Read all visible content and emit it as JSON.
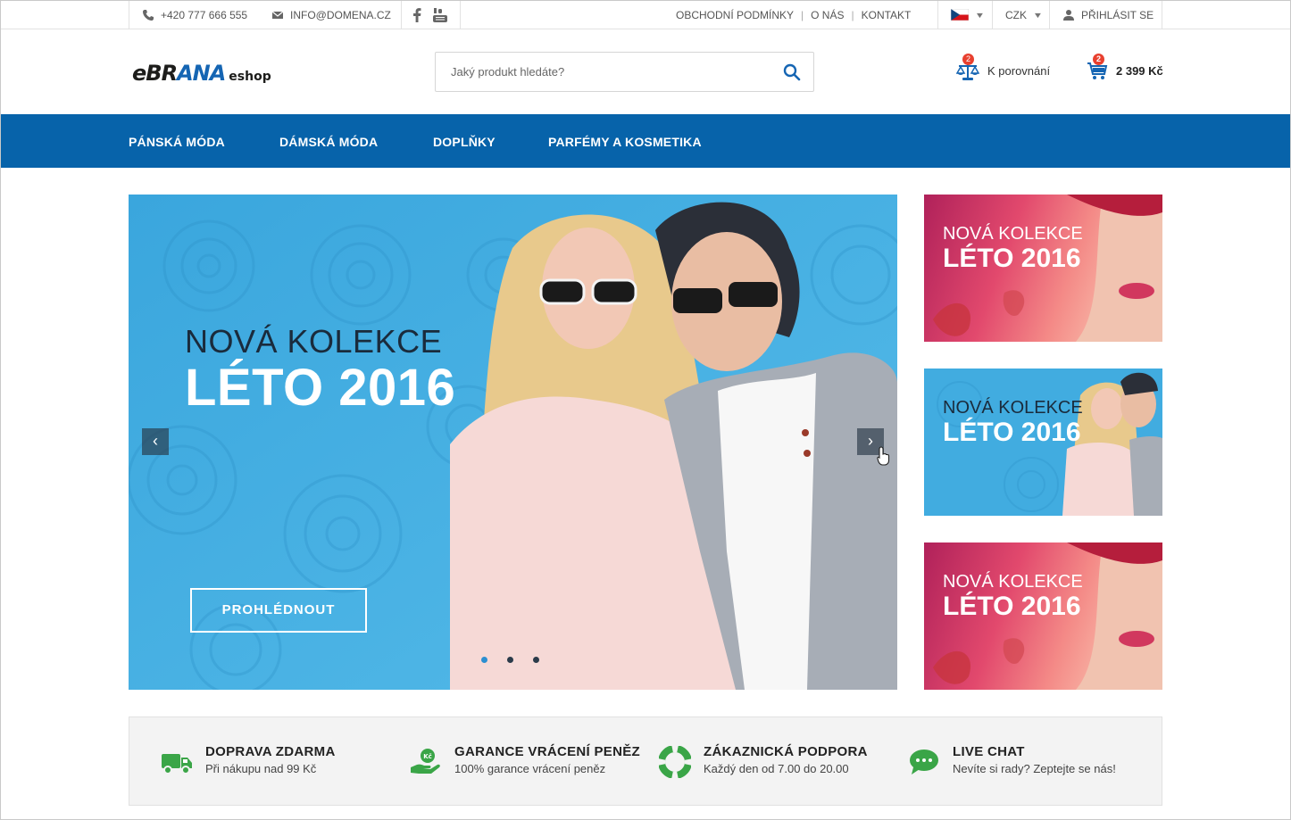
{
  "topbar": {
    "phone": "+420 777 666 555",
    "email": "INFO@DOMENA.CZ",
    "links": [
      "OBCHODNÍ PODMÍNKY",
      "O NÁS",
      "KONTAKT"
    ],
    "currency": "CZK",
    "login": "PŘIHLÁSIT SE"
  },
  "header": {
    "logo_main_a": "eBR",
    "logo_main_b": "ANA",
    "logo_sub": "eshop",
    "search_placeholder": "Jaký produkt hledáte?",
    "compare_label": "K porovnání",
    "compare_count": "2",
    "cart_total": "2 399 Kč",
    "cart_count": "2"
  },
  "nav": {
    "items": [
      "PÁNSKÁ MÓDA",
      "DÁMSKÁ MÓDA",
      "DOPLŇKY",
      "PARFÉMY A KOSMETIKA"
    ]
  },
  "hero": {
    "line1": "NOVÁ KOLEKCE",
    "line2": "LÉTO 2016",
    "cta": "PROHLÉDNOUT",
    "prev": "‹",
    "next": "›"
  },
  "side_banners": [
    {
      "line1": "NOVÁ KOLEKCE",
      "line2": "LÉTO 2016"
    },
    {
      "line1": "NOVÁ KOLEKCE",
      "line2": "LÉTO 2016"
    },
    {
      "line1": "NOVÁ KOLEKCE",
      "line2": "LÉTO 2016"
    }
  ],
  "features": [
    {
      "title": "DOPRAVA ZDARMA",
      "subtitle": "Při nákupu nad 99 Kč",
      "icon": "truck-icon"
    },
    {
      "title": "GARANCE VRÁCENÍ PENĚZ",
      "subtitle": "100% garance vrácení peněz",
      "icon": "money-hand-icon"
    },
    {
      "title": "ZÁKAZNICKÁ PODPORA",
      "subtitle": "Každý den od 7.00 do 20.00",
      "icon": "lifebuoy-icon"
    },
    {
      "title": "LIVE CHAT",
      "subtitle": "Nevíte si rady? Zeptejte se nás!",
      "icon": "chat-icon"
    }
  ],
  "colors": {
    "brand_blue": "#0763aa",
    "accent_green": "#3aa547",
    "badge_red": "#e8402f",
    "hero_blue": "#41ace0"
  }
}
